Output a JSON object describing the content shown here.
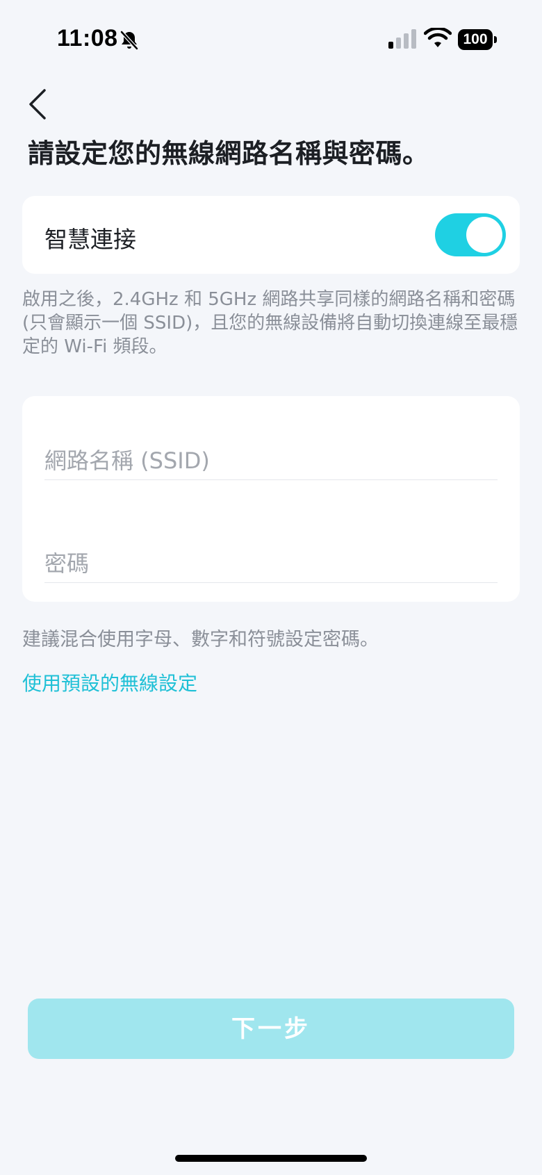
{
  "status_bar": {
    "time": "11:08",
    "battery": "100",
    "icons": [
      "bell-slash-icon",
      "cellular-signal-icon",
      "wifi-icon",
      "battery-icon"
    ]
  },
  "nav": {
    "back_icon": "chevron-left-icon"
  },
  "page": {
    "title": "請設定您的無線網路名稱與密碼。"
  },
  "smart_connect": {
    "label": "智慧連接",
    "enabled": true,
    "description": "啟用之後，2.4GHz 和 5GHz 網路共享同樣的網路名稱和密碼 (只會顯示一個 SSID)，且您的無線設備將自動切換連線至最穩定的 Wi-Fi 頻段。"
  },
  "form": {
    "ssid_placeholder": "網路名稱 (SSID)",
    "ssid_value": "",
    "password_placeholder": "密碼",
    "password_value": ""
  },
  "hint": "建議混合使用字母、數字和符號設定密碼。",
  "default_link": "使用預設的無線設定",
  "next_button": "下一步",
  "colors": {
    "accent": "#1fd0e3",
    "link": "#1fc0d6",
    "button_disabled": "#a0e6ee",
    "background": "#f4f6fa"
  }
}
